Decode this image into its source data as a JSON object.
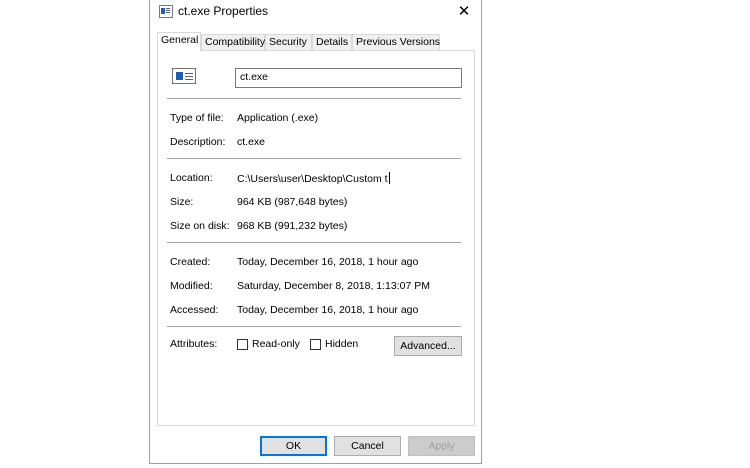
{
  "window": {
    "title": "ct.exe Properties",
    "close_symbol": "✕"
  },
  "tabs": [
    {
      "label": "General"
    },
    {
      "label": "Compatibility"
    },
    {
      "label": "Security"
    },
    {
      "label": "Details"
    },
    {
      "label": "Previous Versions"
    }
  ],
  "general": {
    "file_name": "ct.exe",
    "file_icon": "application-exe-icon",
    "type_label": "Type of file:",
    "type_value": "Application (.exe)",
    "description_label": "Description:",
    "description_value": "ct.exe",
    "location_label": "Location:",
    "location_value": "C:\\Users\\user\\Desktop\\Custom t",
    "size_label": "Size:",
    "size_value": "964 KB (987,648 bytes)",
    "size_on_disk_label": "Size on disk:",
    "size_on_disk_value": "968 KB (991,232 bytes)",
    "created_label": "Created:",
    "created_value": "Today, December 16, 2018, 1 hour ago",
    "modified_label": "Modified:",
    "modified_value": "Saturday, December 8, 2018, 1:13:07 PM",
    "accessed_label": "Accessed:",
    "accessed_value": "Today, December 16, 2018, 1 hour ago",
    "attributes_label": "Attributes:",
    "readonly_label": "Read-only",
    "readonly_checked": false,
    "hidden_label": "Hidden",
    "hidden_checked": false,
    "advanced_label": "Advanced..."
  },
  "footer": {
    "ok_label": "OK",
    "cancel_label": "Cancel",
    "apply_label": "Apply"
  },
  "colors": {
    "accent": "#0078d7",
    "icon_blue": "#1a5fb4"
  }
}
